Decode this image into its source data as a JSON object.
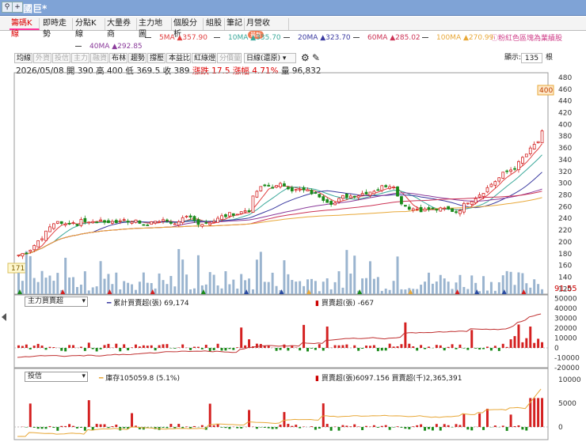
{
  "window": {
    "title": "國巨*",
    "zoom_icon": "magnifier-icon",
    "add_icon": "+"
  },
  "tabs": [
    {
      "label": "technical-k",
      "text": "籌碼K線",
      "active": true
    },
    {
      "label": "intraday",
      "text": "即時走勢"
    },
    {
      "label": "min-k",
      "text": "分點K線"
    },
    {
      "label": "bulk-broker",
      "text": "大量券商"
    },
    {
      "label": "main-map",
      "text": "主力地圖"
    },
    {
      "label": "stock-analysis",
      "text": "個股分析"
    },
    {
      "label": "group",
      "text": "組股"
    },
    {
      "label": "notes",
      "text": "筆記"
    },
    {
      "label": "monthly-revenue",
      "text": "月營收",
      "badge": "最新"
    }
  ],
  "ma_legend": [
    {
      "name": "5MA",
      "arrow": "▲",
      "value": "357.90",
      "color": "#e04040"
    },
    {
      "name": "10MA",
      "arrow": "▲",
      "value": "335.70",
      "color": "#3aa89a"
    },
    {
      "name": "20MA",
      "arrow": "▲",
      "value": "323.70",
      "color": "#3a3aa0"
    },
    {
      "name": "60MA",
      "arrow": "▲",
      "value": "285.02",
      "color": "#cc3355"
    },
    {
      "name": "100MA",
      "arrow": "▲",
      "value": "270.99",
      "color": "#e8a838"
    },
    {
      "name": "40MA",
      "arrow": "▲",
      "value": "292.85",
      "color": "#8a3a9a"
    }
  ],
  "highlight_note": "粉紅色區塊為業績股",
  "toolbar": {
    "items": [
      "均線",
      "外資",
      "投信",
      "主力",
      "融資",
      "布林",
      "趨勢",
      "撐壓",
      "本益比",
      "紅綠燈",
      "分價量"
    ],
    "dim": [
      1,
      2,
      3,
      4,
      10
    ],
    "period_select": "日線(還原)",
    "display_label": "顯示:",
    "display_count": "135",
    "display_unit": "根"
  },
  "quote": {
    "date": "2026/05/08",
    "open_label": "開",
    "open": "390",
    "high_label": "高",
    "high": "400",
    "low_label": "低",
    "low": "369.5",
    "close_label": "收",
    "close": "389",
    "change_label": "漲跌",
    "change": "17.5",
    "pct_label": "漲幅",
    "pct": "4.71%",
    "vol_label": "量",
    "vol": "96,832"
  },
  "main_chart": {
    "price_axis": [
      "480",
      "460",
      "440",
      "420",
      "400",
      "380",
      "360",
      "340",
      "320",
      "300",
      "280",
      "260",
      "240",
      "220",
      "200",
      "180",
      "160",
      "140",
      "120"
    ],
    "high_marker": "400",
    "low_marker": "171",
    "right_bottom_value": "91.55"
  },
  "panel1": {
    "select": "主力買賣超",
    "legend_cum": "累計買賣超(張) 69,174",
    "legend_net": "買賣超(張) -667",
    "axis": [
      "50000",
      "40000",
      "30000",
      "20000",
      "10000",
      "0",
      "-10000",
      "-20000"
    ]
  },
  "panel2": {
    "select": "投信",
    "legend_inv": "庫存105059.8 (5.1%)",
    "legend_net": "買賣超(張)6097.156 買賣超(千)2,365,391",
    "axis": [
      "10000",
      "5000",
      "0"
    ]
  },
  "chart_data": {
    "type": "candlestick",
    "title": "",
    "y_axis": [
      120,
      480
    ],
    "last_close": 389,
    "last_high": 400,
    "period_low": 171,
    "colors": {
      "up": "#d42020",
      "down": "#1a8a1a",
      "volume": "#9ab4cf"
    }
  }
}
